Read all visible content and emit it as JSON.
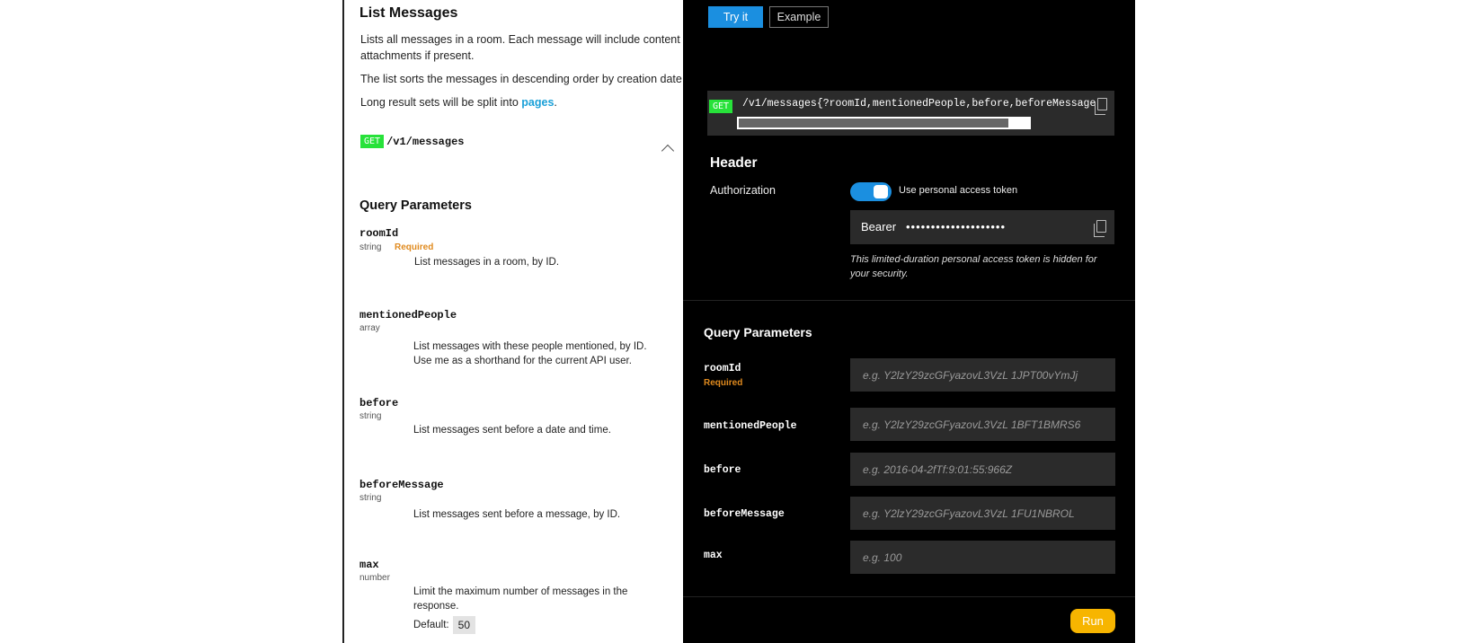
{
  "docs": {
    "title": "List Messages",
    "description_1": "Lists all messages in a room. Each message will include content",
    "description_1b": "attachments if present.",
    "description_2": "The list sorts the messages in descending order by creation date.",
    "description_3_prefix": "Long result sets will be split into ",
    "description_3_link": "pages",
    "description_3_suffix": ".",
    "method": "GET",
    "endpoint": "/v1/messages",
    "query_params_title": "Query Parameters",
    "params": [
      {
        "name": "roomId",
        "type": "string",
        "required": "Required",
        "desc_1": "List messages in a room, by ID.",
        "desc_2": ""
      },
      {
        "name": "mentionedPeople",
        "type": "array",
        "required": "",
        "desc_1": "List messages with these people mentioned, by ID.",
        "desc_2": "Use me as a shorthand for the current API user."
      },
      {
        "name": "before",
        "type": "string",
        "required": "",
        "desc_1": "List messages sent before a date and time.",
        "desc_2": ""
      },
      {
        "name": "beforeMessage",
        "type": "string",
        "required": "",
        "desc_1": "List messages sent before a message, by ID.",
        "desc_2": ""
      },
      {
        "name": "max",
        "type": "number",
        "required": "",
        "desc_1": "Limit the maximum number of messages in the",
        "desc_2": "response."
      }
    ],
    "default_label": "Default:",
    "default_value": "50"
  },
  "console": {
    "try_it_label": "Try it",
    "example_label": "Example",
    "method": "GET",
    "url": "/v1/messages{?roomId,mentionedPeople,before,beforeMessage",
    "url_scroll_fraction": 0.93,
    "header_title": "Header",
    "authorization_label": "Authorization",
    "toggle_label": "Use personal access token",
    "bearer_label": "Bearer",
    "token_masked": "••••••••••••••••••••",
    "token_note": "This limited-duration personal access token is hidden for your security.",
    "query_params_title": "Query Parameters",
    "params": [
      {
        "name": "roomId",
        "required": "Required",
        "placeholder": "e.g. Y2lzY29zcGFyazovL3VzL 1JPT00vYmJj"
      },
      {
        "name": "mentionedPeople",
        "required": "",
        "placeholder": "e.g. Y2lzY29zcGFyazovL3VzL 1BFT1BMRS6"
      },
      {
        "name": "before",
        "required": "",
        "placeholder": "e.g. 2016-04-2fTf:9:01:55:966Z"
      },
      {
        "name": "beforeMessage",
        "required": "",
        "placeholder": "e.g. Y2lzY29zcGFyazovL3VzL 1FU1NBROL"
      },
      {
        "name": "max",
        "required": "",
        "placeholder": "e.g. 100"
      }
    ],
    "run_label": "Run"
  },
  "colors": {
    "accent_blue": "#1b8fe0",
    "method_green": "#27e23a",
    "required_orange": "#e08a1e",
    "run_yellow": "#f7b500",
    "link_blue": "#1aa0d8"
  }
}
